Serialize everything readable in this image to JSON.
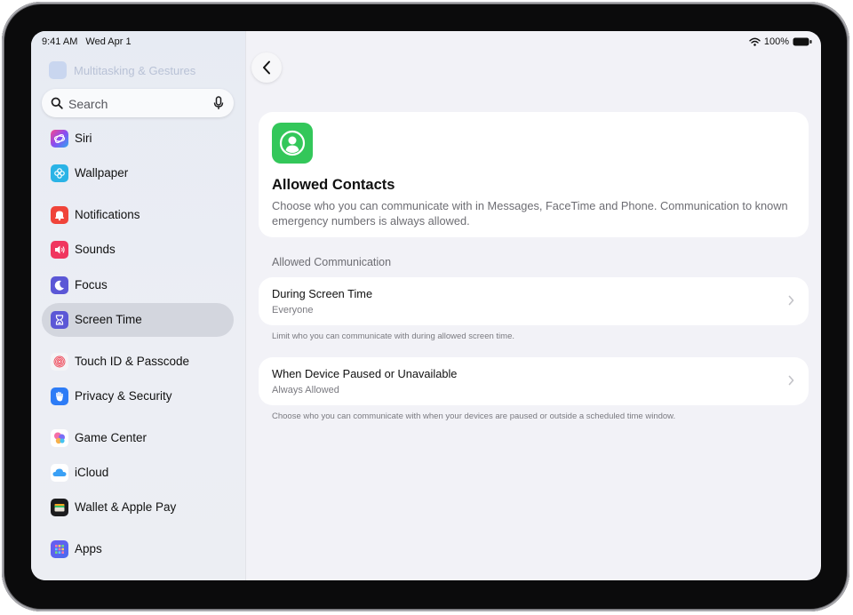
{
  "status": {
    "time": "9:41 AM",
    "date": "Wed Apr 1",
    "battery": "100%"
  },
  "sidebar": {
    "ghost_items": [
      {
        "label": "Multitasking & Gestures"
      }
    ],
    "search": {
      "placeholder": "Search"
    },
    "items": [
      {
        "label": "Siri",
        "icon": "siri-icon",
        "color": "#e24a8a"
      },
      {
        "label": "Wallpaper",
        "icon": "wallpaper-icon",
        "color": "#2ab3e6"
      },
      {
        "label": "Notifications",
        "icon": "notifications-icon",
        "color": "#f0443a"
      },
      {
        "label": "Sounds",
        "icon": "sounds-icon",
        "color": "#f0365f"
      },
      {
        "label": "Focus",
        "icon": "focus-icon",
        "color": "#5b57d6"
      },
      {
        "label": "Screen Time",
        "icon": "screen-time-icon",
        "color": "#5b57d6",
        "active": true
      },
      {
        "label": "Touch ID & Passcode",
        "icon": "fingerprint-icon",
        "color": "#f2f2f4"
      },
      {
        "label": "Privacy & Security",
        "icon": "hand-icon",
        "color": "#2d7cf6"
      },
      {
        "label": "Game Center",
        "icon": "game-center-icon",
        "color": "#ffffff"
      },
      {
        "label": "iCloud",
        "icon": "icloud-icon",
        "color": "#ffffff"
      },
      {
        "label": "Wallet & Apple Pay",
        "icon": "wallet-icon",
        "color": "#1c1c1e"
      },
      {
        "label": "Apps",
        "icon": "apps-icon",
        "color": "#5b57d6"
      }
    ]
  },
  "main": {
    "title": "Allowed Contacts",
    "description": "Choose who you can communicate with in Messages, FaceTime and Phone. Communication to known emergency numbers is always allowed.",
    "section_header": "Allowed Communication",
    "rows": [
      {
        "title": "During Screen Time",
        "value": "Everyone",
        "footer": "Limit who you can communicate with during allowed screen time."
      },
      {
        "title": "When Device Paused or Unavailable",
        "value": "Always Allowed",
        "footer": "Choose who you can communicate with when your devices are paused or outside a scheduled time window."
      }
    ]
  },
  "colors": {
    "accent_green": "#33c75a",
    "selection": "#d3d6de"
  }
}
